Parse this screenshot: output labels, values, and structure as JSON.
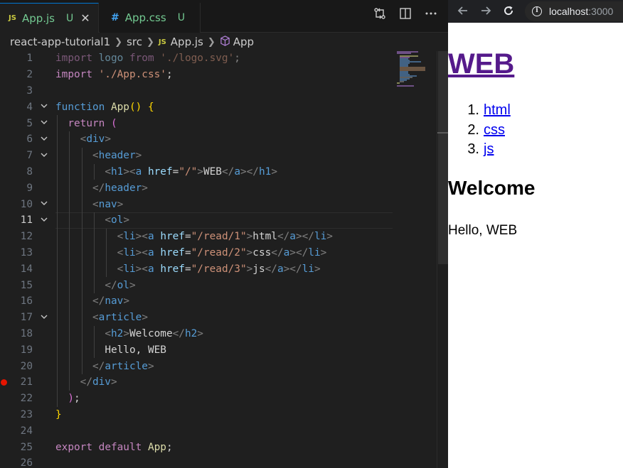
{
  "editor": {
    "tabs": [
      {
        "icon": "JS",
        "label": "App.js",
        "status": "U",
        "close": "✕"
      },
      {
        "icon": "#",
        "label": "App.css",
        "status": "U"
      }
    ],
    "breadcrumb": {
      "folder": "react-app-tutorial1",
      "sub": "src",
      "file_icon": "JS",
      "file": "App.js",
      "symbol": "App"
    },
    "active_line": 11,
    "breakpoint_line": 21,
    "lines": [
      {
        "n": 1,
        "fold": false,
        "html": "<span class='kw dim'>import</span><span class='var dim'> logo </span><span class='kw dim'>from</span><span class='str dim'> './logo.svg'</span><span class='txt dim'>;</span>"
      },
      {
        "n": 2,
        "fold": false,
        "html": "<span class='kw'>import</span><span class='str'> './App.css'</span><span class='txt'>;</span>"
      },
      {
        "n": 3,
        "fold": false,
        "html": ""
      },
      {
        "n": 4,
        "fold": true,
        "html": "<span class='kwb'>function</span> <span class='fn'>App</span><span class='yb'>()</span> <span class='yb'>{</span>"
      },
      {
        "n": 5,
        "fold": true,
        "html": "  <span class='kw'>return</span> <span class='pb'>(</span>"
      },
      {
        "n": 6,
        "fold": true,
        "html": "    <span class='tagc'>&lt;</span><span class='tagn'>div</span><span class='tagc'>&gt;</span>"
      },
      {
        "n": 7,
        "fold": true,
        "html": "      <span class='tagc'>&lt;</span><span class='tagn'>header</span><span class='tagc'>&gt;</span>"
      },
      {
        "n": 8,
        "fold": false,
        "html": "        <span class='tagc'>&lt;</span><span class='tagn'>h1</span><span class='tagc'>&gt;&lt;</span><span class='tagn'>a</span> <span class='attr'>href</span><span class='txt'>=</span><span class='str'>\"/\"</span><span class='tagc'>&gt;</span><span class='txt'>WEB</span><span class='tagc'>&lt;/</span><span class='tagn'>a</span><span class='tagc'>&gt;&lt;/</span><span class='tagn'>h1</span><span class='tagc'>&gt;</span>"
      },
      {
        "n": 9,
        "fold": false,
        "html": "      <span class='tagc'>&lt;/</span><span class='tagn'>header</span><span class='tagc'>&gt;</span>"
      },
      {
        "n": 10,
        "fold": true,
        "html": "      <span class='tagc'>&lt;</span><span class='tagn'>nav</span><span class='tagc'>&gt;</span>"
      },
      {
        "n": 11,
        "fold": true,
        "html": "        <span class='tagc'>&lt;</span><span class='tagn'>ol</span><span class='tagc'>&gt;</span>"
      },
      {
        "n": 12,
        "fold": false,
        "html": "          <span class='tagc'>&lt;</span><span class='tagn'>li</span><span class='tagc'>&gt;&lt;</span><span class='tagn'>a</span> <span class='attr'>href</span><span class='txt'>=</span><span class='str'>\"/read/1\"</span><span class='tagc'>&gt;</span><span class='txt'>html</span><span class='tagc'>&lt;/</span><span class='tagn'>a</span><span class='tagc'>&gt;&lt;/</span><span class='tagn'>li</span><span class='tagc'>&gt;</span>"
      },
      {
        "n": 13,
        "fold": false,
        "html": "          <span class='tagc'>&lt;</span><span class='tagn'>li</span><span class='tagc'>&gt;&lt;</span><span class='tagn'>a</span> <span class='attr'>href</span><span class='txt'>=</span><span class='str'>\"/read/2\"</span><span class='tagc'>&gt;</span><span class='txt'>css</span><span class='tagc'>&lt;/</span><span class='tagn'>a</span><span class='tagc'>&gt;&lt;/</span><span class='tagn'>li</span><span class='tagc'>&gt;</span>"
      },
      {
        "n": 14,
        "fold": false,
        "html": "          <span class='tagc'>&lt;</span><span class='tagn'>li</span><span class='tagc'>&gt;&lt;</span><span class='tagn'>a</span> <span class='attr'>href</span><span class='txt'>=</span><span class='str'>\"/read/3\"</span><span class='tagc'>&gt;</span><span class='txt'>js</span><span class='tagc'>&lt;/</span><span class='tagn'>a</span><span class='tagc'>&gt;&lt;/</span><span class='tagn'>li</span><span class='tagc'>&gt;</span>"
      },
      {
        "n": 15,
        "fold": false,
        "html": "        <span class='tagc'>&lt;/</span><span class='tagn'>ol</span><span class='tagc'>&gt;</span>"
      },
      {
        "n": 16,
        "fold": false,
        "html": "      <span class='tagc'>&lt;/</span><span class='tagn'>nav</span><span class='tagc'>&gt;</span>"
      },
      {
        "n": 17,
        "fold": true,
        "html": "      <span class='tagc'>&lt;</span><span class='tagn'>article</span><span class='tagc'>&gt;</span>"
      },
      {
        "n": 18,
        "fold": false,
        "html": "        <span class='tagc'>&lt;</span><span class='tagn'>h2</span><span class='tagc'>&gt;</span><span class='txt'>Welcome</span><span class='tagc'>&lt;/</span><span class='tagn'>h2</span><span class='tagc'>&gt;</span>"
      },
      {
        "n": 19,
        "fold": false,
        "html": "        <span class='txt'>Hello, WEB</span>"
      },
      {
        "n": 20,
        "fold": false,
        "html": "      <span class='tagc'>&lt;/</span><span class='tagn'>article</span><span class='tagc'>&gt;</span>"
      },
      {
        "n": 21,
        "fold": false,
        "html": "    <span class='tagc'>&lt;/</span><span class='tagn'>div</span><span class='tagc'>&gt;</span>"
      },
      {
        "n": 22,
        "fold": false,
        "html": "  <span class='pb'>)</span><span class='txt'>;</span>"
      },
      {
        "n": 23,
        "fold": false,
        "html": "<span class='yb'>}</span>"
      },
      {
        "n": 24,
        "fold": false,
        "html": ""
      },
      {
        "n": 25,
        "fold": false,
        "html": "<span class='kw'>export</span> <span class='kw'>default</span> <span class='fn'>App</span><span class='txt'>;</span>"
      },
      {
        "n": 26,
        "fold": false,
        "html": ""
      }
    ],
    "colors": {
      "accent": "#0078d4",
      "breakpoint": "#e51400",
      "untracked": "#73c991"
    }
  },
  "browser": {
    "url_host": "localhost",
    "url_port": ":3000",
    "page": {
      "h1": "WEB",
      "list": [
        {
          "num": "1.",
          "label": "html"
        },
        {
          "num": "2.",
          "label": "css"
        },
        {
          "num": "3.",
          "label": "js"
        }
      ],
      "h2": "Welcome",
      "body": "Hello, WEB"
    }
  }
}
